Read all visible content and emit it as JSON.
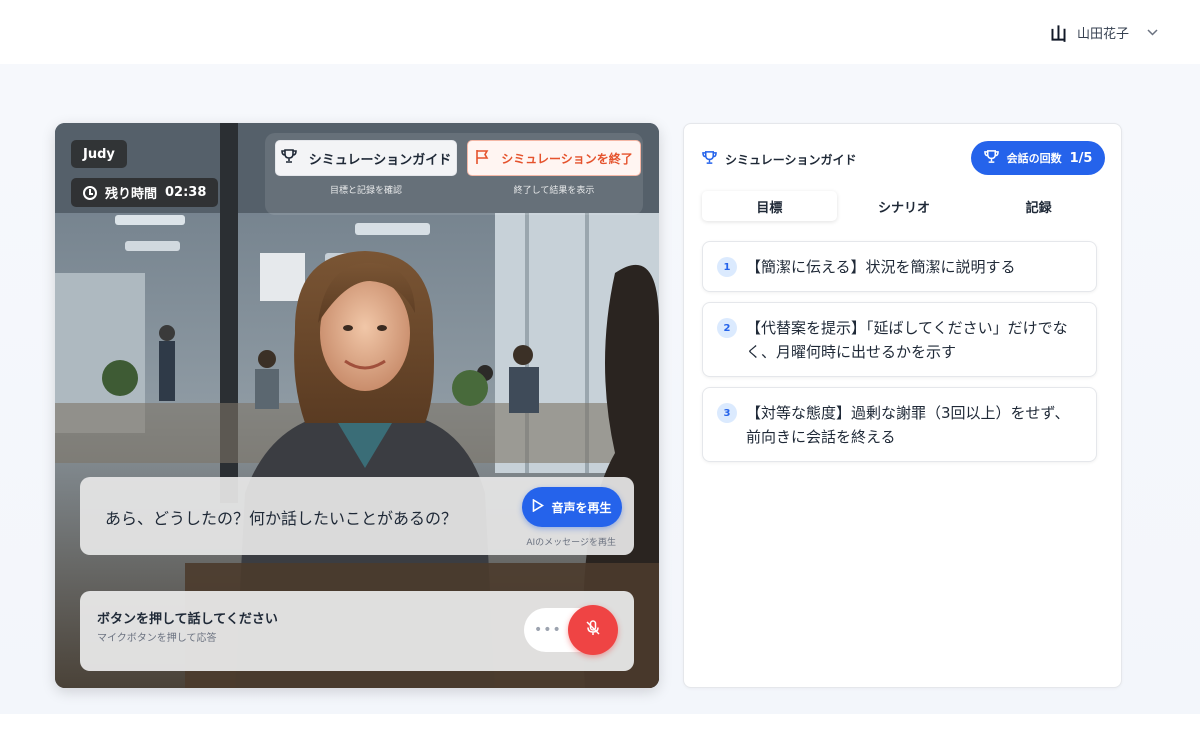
{
  "header": {
    "user_avatar": "山",
    "user_name": "山田花子"
  },
  "video": {
    "name_tag": "Judy",
    "timer_label": "残り時間",
    "timer_value": "02:38",
    "guide_button": "シミュレーションガイド",
    "guide_caption": "目標と記録を確認",
    "end_button": "シミュレーションを終了",
    "end_caption": "終了して結果を表示",
    "message": "あら、どうしたの？何か話したいことがあるの？",
    "play_button": "音声を再生",
    "play_caption": "AIのメッセージを再生",
    "record_title": "ボタンを押して話してください",
    "record_subtitle": "マイクボタンを押して応答",
    "record_dots": "•••"
  },
  "panel": {
    "title": "シミュレーションガイド",
    "count_label": "会話の回数",
    "count_value": "1/5",
    "tabs": [
      "目標",
      "シナリオ",
      "記録"
    ],
    "active_tab": "目標",
    "goals": [
      {
        "num": "1",
        "text": "【簡潔に伝える】状況を簡潔に説明する"
      },
      {
        "num": "2",
        "text": "【代替案を提示】「延ばしてください」だけでなく、月曜何時に出せるかを示す"
      },
      {
        "num": "3",
        "text": "【対等な態度】過剰な謝罪（3回以上）をせず、前向きに会話を終える"
      }
    ]
  },
  "colors": {
    "accent": "#2563eb",
    "danger": "#ef4444",
    "end_text": "#e5532d"
  }
}
